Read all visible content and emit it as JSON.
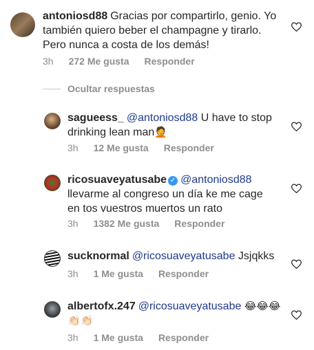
{
  "root_comment": {
    "username": "antoniosd88",
    "text": "Gracias por compartirlo, genio. Yo también quiero beber el champagne y tirarlo. Pero nunca a costa de los demás!",
    "time": "3h",
    "likes": "272 Me gusta",
    "reply": "Responder"
  },
  "hide_replies": "Ocultar respuestas",
  "replies": [
    {
      "username": "sagueess_",
      "mention": "@antoniosd88",
      "text": " U have to stop drinking lean man",
      "emoji": "🤦",
      "time": "3h",
      "likes": "12 Me gusta",
      "reply": "Responder"
    },
    {
      "username": "ricosuaveyatusabe",
      "verified": true,
      "mention": "@antoniosd88",
      "text": "llevarme al congreso un día ke me cage en tos vuestros muertos un rato",
      "time": "3h",
      "likes": "1382 Me gusta",
      "reply": "Responder"
    },
    {
      "username": "sucknormal",
      "mention": "@ricosuaveyatusabe",
      "text": " Jsjqkks",
      "time": "3h",
      "likes": "1 Me gusta",
      "reply": "Responder"
    },
    {
      "username": "albertofx.247",
      "mention": "@ricosuaveyatusabe",
      "text": " ",
      "emoji_line": "😂😂😂👏🏻👏🏻",
      "time": "3h",
      "likes": "1 Me gusta",
      "reply": "Responder"
    }
  ],
  "icons": {
    "like": "heart-outline-icon",
    "verified": "verified-badge-icon"
  },
  "colors": {
    "text": "#262626",
    "meta": "#8e8e8e",
    "mention": "#1f3a8a",
    "verified": "#3897f0"
  }
}
